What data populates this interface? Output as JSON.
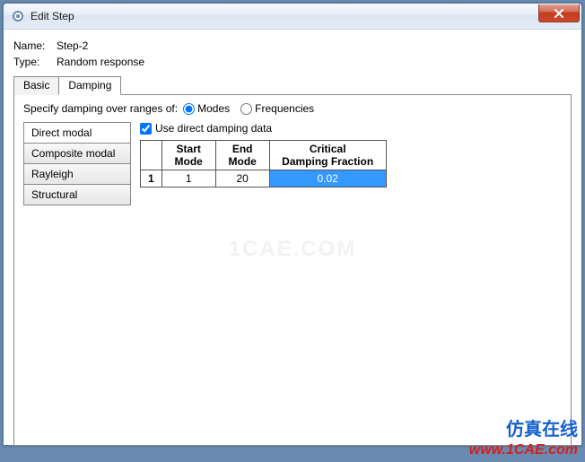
{
  "window": {
    "title": "Edit Step"
  },
  "name": {
    "label": "Name:",
    "value": "Step-2"
  },
  "type": {
    "label": "Type:",
    "value": "Random response"
  },
  "tabs": {
    "basic": "Basic",
    "damping": "Damping"
  },
  "specify": {
    "label": "Specify damping over ranges of:",
    "modes": "Modes",
    "frequencies": "Frequencies"
  },
  "sideTabs": {
    "directModal": "Direct modal",
    "compositeModal": "Composite modal",
    "rayleigh": "Rayleigh",
    "structural": "Structural"
  },
  "checkbox": {
    "label": "Use direct damping data"
  },
  "table": {
    "headers": {
      "start": "Start\nMode",
      "end": "End\nMode",
      "crit": "Critical\nDamping Fraction"
    },
    "rows": [
      {
        "n": "1",
        "start": "1",
        "end": "20",
        "crit": "0.02"
      }
    ]
  },
  "watermark": "1CAE.COM",
  "footer": {
    "cn": "仿真在线",
    "url": "www.1CAE.com"
  }
}
